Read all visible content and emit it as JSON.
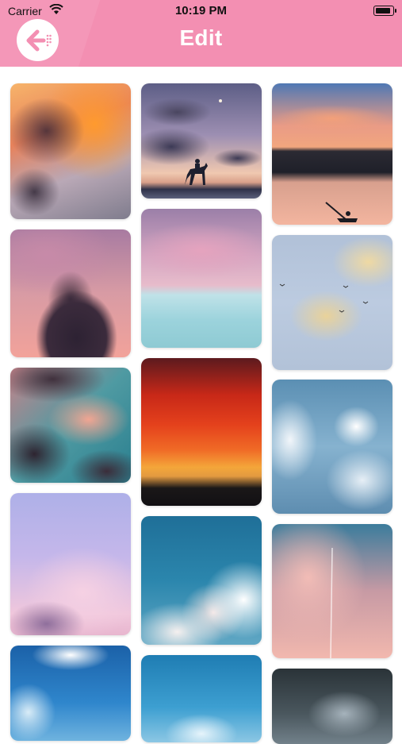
{
  "status": {
    "carrier": "Carrier",
    "time": "10:19 PM"
  },
  "header": {
    "title": "Edit",
    "back_icon": "arrow-left-icon"
  },
  "colors": {
    "header_bg": "#f38fb2",
    "title": "#ffffff",
    "page_bg": "#ffffff"
  },
  "gallery": {
    "columns": [
      {
        "tiles": [
          {
            "name": "photo-orange-storm-cloud"
          },
          {
            "name": "photo-purple-cumulus"
          },
          {
            "name": "photo-teal-sunset-clouds"
          },
          {
            "name": "photo-lavender-pink-sky"
          },
          {
            "name": "photo-blue-sunrays"
          }
        ]
      },
      {
        "tiles": [
          {
            "name": "photo-horse-rider-sunset"
          },
          {
            "name": "photo-pink-sea-horizon"
          },
          {
            "name": "photo-red-fire-sky"
          },
          {
            "name": "photo-blue-cloud-puffs"
          },
          {
            "name": "photo-blue-cloud-bottom"
          }
        ]
      },
      {
        "tiles": [
          {
            "name": "photo-lake-kayak-sunset"
          },
          {
            "name": "photo-yellow-clouds-birds"
          },
          {
            "name": "photo-blue-sky-sun"
          },
          {
            "name": "photo-pink-cirrus-contrail"
          },
          {
            "name": "photo-dark-storm-clouds"
          }
        ]
      }
    ]
  }
}
